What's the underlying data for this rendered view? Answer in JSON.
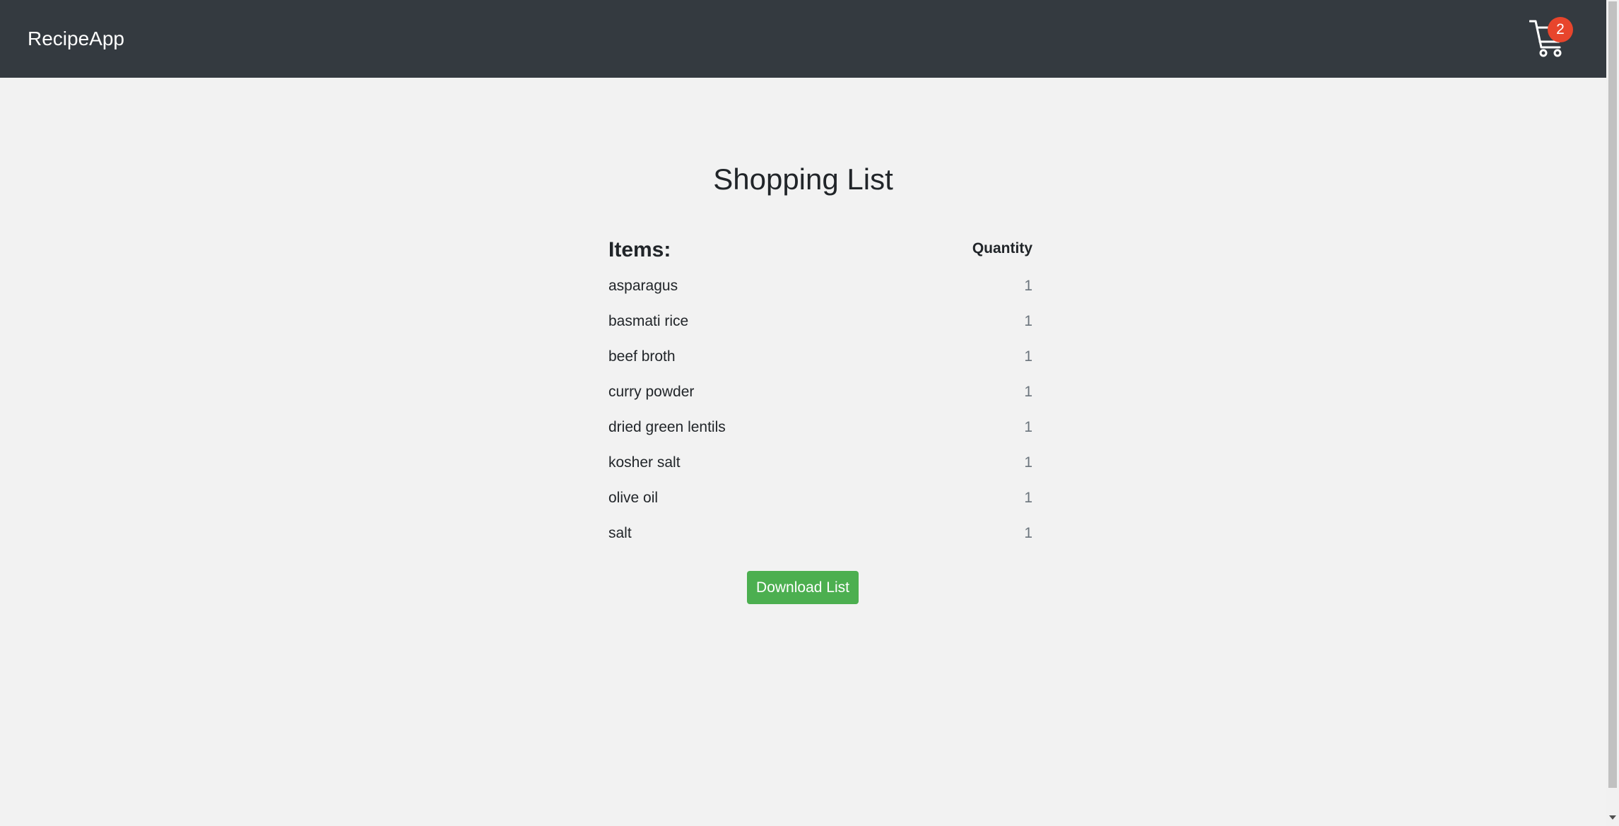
{
  "navbar": {
    "brand": "RecipeApp",
    "cart_icon": "shopping-cart-icon",
    "cart_count": "2"
  },
  "page": {
    "title": "Shopping List"
  },
  "list": {
    "items_heading": "Items:",
    "quantity_heading": "Quantity",
    "rows": [
      {
        "name": "asparagus",
        "qty": "1"
      },
      {
        "name": "basmati rice",
        "qty": "1"
      },
      {
        "name": "beef broth",
        "qty": "1"
      },
      {
        "name": "curry powder",
        "qty": "1"
      },
      {
        "name": "dried green lentils",
        "qty": "1"
      },
      {
        "name": "kosher salt",
        "qty": "1"
      },
      {
        "name": "olive oil",
        "qty": "1"
      },
      {
        "name": "salt",
        "qty": "1"
      }
    ]
  },
  "actions": {
    "download_label": "Download List"
  },
  "colors": {
    "navbar_bg": "#343a40",
    "page_bg": "#f2f2f2",
    "badge": "#e8452c",
    "button": "#4caf50"
  }
}
